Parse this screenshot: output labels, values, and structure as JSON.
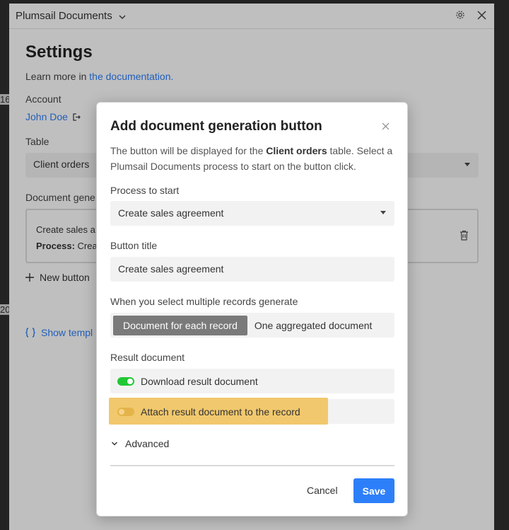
{
  "window": {
    "title": "Plumsail Documents"
  },
  "settings": {
    "heading": "Settings",
    "learn_prefix": "Learn more in ",
    "learn_link": "the documentation.",
    "account_label": "Account",
    "account_name": "John Doe",
    "table_label": "Table",
    "table_value": "Client orders",
    "docgen_label": "Document gene",
    "docgen_item_title": "Create sales a",
    "docgen_item_process_label": "Process:",
    "docgen_item_process_value": " Crea",
    "new_button": "New button",
    "show_templates": "Show templ"
  },
  "background_fragments": {
    "left_top": "16",
    "left_bottom": "20"
  },
  "modal": {
    "title": "Add document generation button",
    "desc_prefix": "The button will be displayed for the ",
    "desc_table": "Client orders",
    "desc_suffix": " table. Select a Plumsail Documents process to start on the button click.",
    "process_label": "Process to start",
    "process_value": "Create sales agreement",
    "button_title_label": "Button title",
    "button_title_value": "Create sales agreement",
    "multi_label": "When you select multiple records generate",
    "multi_options": [
      "Document for each record",
      "One aggregated document"
    ],
    "result_label": "Result document",
    "download_toggle": "Download result document",
    "attach_toggle": "Attach result document to the record",
    "advanced": "Advanced",
    "cancel": "Cancel",
    "save": "Save"
  },
  "colors": {
    "accent": "#2d7ff9",
    "toggle_on": "#20c933",
    "highlight": "#f1c86d"
  }
}
